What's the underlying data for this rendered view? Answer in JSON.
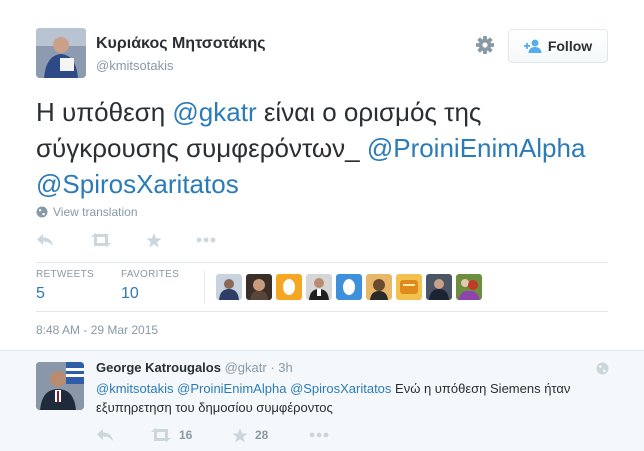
{
  "tweet": {
    "author": {
      "fullname": "Κυριάκος Μητσοτάκης",
      "username": "@kmitsotakis"
    },
    "follow_label": "Follow",
    "text_parts": {
      "p1": "Η υπόθεση ",
      "m1": "@gkatr",
      "p2": " είναι ο ορισμός της σύγκρουσης συμφερόντων_ ",
      "m2": "@ProiniEnimAlpha",
      "p3": " ",
      "m3": "@SpirosXaritatos"
    },
    "view_translation": "View translation",
    "stats": {
      "retweets_label": "RETWEETS",
      "retweets": "5",
      "favorites_label": "FAVORITES",
      "favorites": "10"
    },
    "timestamp": "8:48 AM - 29 Mar 2015"
  },
  "reply": {
    "fullname": "George Katrougalos",
    "username": "@gkatr",
    "time_separator": "·",
    "time": "3h",
    "text_parts": {
      "m1": "@kmitsotakis",
      "s1": " ",
      "m2": "@ProiniEnimAlpha",
      "s2": " ",
      "m3": "@SpirosXaritatos",
      "p1": " Ενώ η υπόθεση Siemens ήταν εξυπηρετηση του δημοσίου συμφέροντος"
    },
    "retweets": "16",
    "favorites": "28"
  },
  "colors": {
    "link": "#2b7bb9",
    "text": "#292f33",
    "muted": "#8899a6",
    "icon": "#ccd6dd",
    "reply_bg": "#f5f8fa",
    "border": "#e1e8ed"
  },
  "icons": {
    "gear": "gear-icon",
    "follow": "add-user-icon",
    "globe": "globe-icon",
    "reply": "reply-icon",
    "retweet": "retweet-icon",
    "favorite": "star-icon",
    "more": "more-icon"
  }
}
